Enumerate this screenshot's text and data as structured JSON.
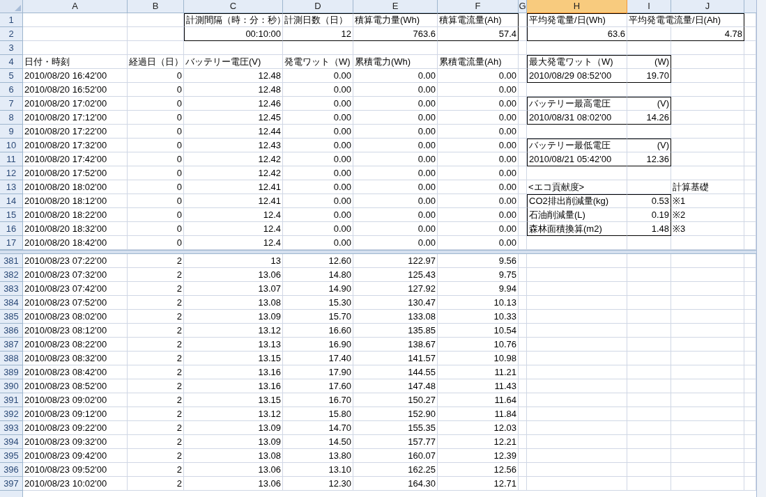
{
  "columns": [
    {
      "label": "A",
      "selected": false
    },
    {
      "label": "B",
      "selected": false
    },
    {
      "label": "C",
      "selected": false
    },
    {
      "label": "D",
      "selected": false
    },
    {
      "label": "E",
      "selected": false
    },
    {
      "label": "F",
      "selected": false
    },
    {
      "label": "G",
      "selected": false
    },
    {
      "label": "H",
      "selected": true
    },
    {
      "label": "I",
      "selected": false
    },
    {
      "label": "J",
      "selected": false
    }
  ],
  "panes": [
    {
      "rows": [
        {
          "n": "1",
          "cells": {
            "C": "計測間隔（時：分：秒）",
            "D": "計測日数（日）",
            "E": "積算電力量(Wh)",
            "F": "積算電流量(Ah)",
            "H": "平均発電量/日(Wh)",
            "I": "平均発電電流量/日(Ah)"
          }
        },
        {
          "n": "2",
          "cells": {
            "C": "00:10:00",
            "D": "12",
            "E": "763.6",
            "F": "57.4",
            "H": "63.6",
            "J": "4.78"
          }
        },
        {
          "n": "3",
          "cells": {}
        },
        {
          "n": "4",
          "cells": {
            "A": "日付・時刻",
            "B": "経過日（日）",
            "C": "バッテリー電圧(V)",
            "D": "発電ワット（W)",
            "E": "累積電力(Wh)",
            "F": "累積電流量(Ah)",
            "H": "最大発電ワット（W)",
            "I": "(W)"
          }
        },
        {
          "n": "5",
          "cells": {
            "A": "2010/08/20 16:42'00",
            "B": "0",
            "C": "12.48",
            "D": "0.00",
            "E": "0.00",
            "F": "0.00",
            "H": "2010/08/29 08:52'00",
            "I": "19.70"
          }
        },
        {
          "n": "6",
          "cells": {
            "A": "2010/08/20 16:52'00",
            "B": "0",
            "C": "12.48",
            "D": "0.00",
            "E": "0.00",
            "F": "0.00"
          }
        },
        {
          "n": "7",
          "cells": {
            "A": "2010/08/20 17:02'00",
            "B": "0",
            "C": "12.46",
            "D": "0.00",
            "E": "0.00",
            "F": "0.00",
            "H": "バッテリー最高電圧",
            "I": "(V)"
          }
        },
        {
          "n": "8",
          "cells": {
            "A": "2010/08/20 17:12'00",
            "B": "0",
            "C": "12.45",
            "D": "0.00",
            "E": "0.00",
            "F": "0.00",
            "H": "2010/08/31 08:02'00",
            "I": "14.26"
          }
        },
        {
          "n": "9",
          "cells": {
            "A": "2010/08/20 17:22'00",
            "B": "0",
            "C": "12.44",
            "D": "0.00",
            "E": "0.00",
            "F": "0.00"
          }
        },
        {
          "n": "10",
          "cells": {
            "A": "2010/08/20 17:32'00",
            "B": "0",
            "C": "12.43",
            "D": "0.00",
            "E": "0.00",
            "F": "0.00",
            "H": "バッテリー最低電圧",
            "I": "(V)"
          }
        },
        {
          "n": "11",
          "cells": {
            "A": "2010/08/20 17:42'00",
            "B": "0",
            "C": "12.42",
            "D": "0.00",
            "E": "0.00",
            "F": "0.00",
            "H": "2010/08/21 05:42'00",
            "I": "12.36"
          }
        },
        {
          "n": "12",
          "cells": {
            "A": "2010/08/20 17:52'00",
            "B": "0",
            "C": "12.42",
            "D": "0.00",
            "E": "0.00",
            "F": "0.00"
          }
        },
        {
          "n": "13",
          "cells": {
            "A": "2010/08/20 18:02'00",
            "B": "0",
            "C": "12.41",
            "D": "0.00",
            "E": "0.00",
            "F": "0.00",
            "H": "<エコ貢献度>",
            "J": "計算基礎"
          }
        },
        {
          "n": "14",
          "cells": {
            "A": "2010/08/20 18:12'00",
            "B": "0",
            "C": "12.41",
            "D": "0.00",
            "E": "0.00",
            "F": "0.00",
            "H": "CO2排出削減量(kg)",
            "I": "0.53",
            "J": "※1"
          }
        },
        {
          "n": "15",
          "cells": {
            "A": "2010/08/20 18:22'00",
            "B": "0",
            "C": "12.4",
            "D": "0.00",
            "E": "0.00",
            "F": "0.00",
            "H": "石油削減量(L)",
            "I": "0.19",
            "J": "※2"
          }
        },
        {
          "n": "16",
          "cells": {
            "A": "2010/08/20 18:32'00",
            "B": "0",
            "C": "12.4",
            "D": "0.00",
            "E": "0.00",
            "F": "0.00",
            "H": "森林面積換算(m2)",
            "I": "1.48",
            "J": "※3"
          }
        },
        {
          "n": "17",
          "cells": {
            "A": "2010/08/20 18:42'00",
            "B": "0",
            "C": "12.4",
            "D": "0.00",
            "E": "0.00",
            "F": "0.00"
          }
        }
      ]
    },
    {
      "rows": [
        {
          "n": "381",
          "cells": {
            "A": "2010/08/23 07:22'00",
            "B": "2",
            "C": "13",
            "D": "12.60",
            "E": "122.97",
            "F": "9.56"
          }
        },
        {
          "n": "382",
          "cells": {
            "A": "2010/08/23 07:32'00",
            "B": "2",
            "C": "13.06",
            "D": "14.80",
            "E": "125.43",
            "F": "9.75"
          }
        },
        {
          "n": "383",
          "cells": {
            "A": "2010/08/23 07:42'00",
            "B": "2",
            "C": "13.07",
            "D": "14.90",
            "E": "127.92",
            "F": "9.94"
          }
        },
        {
          "n": "384",
          "cells": {
            "A": "2010/08/23 07:52'00",
            "B": "2",
            "C": "13.08",
            "D": "15.30",
            "E": "130.47",
            "F": "10.13"
          }
        },
        {
          "n": "385",
          "cells": {
            "A": "2010/08/23 08:02'00",
            "B": "2",
            "C": "13.09",
            "D": "15.70",
            "E": "133.08",
            "F": "10.33"
          }
        },
        {
          "n": "386",
          "cells": {
            "A": "2010/08/23 08:12'00",
            "B": "2",
            "C": "13.12",
            "D": "16.60",
            "E": "135.85",
            "F": "10.54"
          }
        },
        {
          "n": "387",
          "cells": {
            "A": "2010/08/23 08:22'00",
            "B": "2",
            "C": "13.13",
            "D": "16.90",
            "E": "138.67",
            "F": "10.76"
          }
        },
        {
          "n": "388",
          "cells": {
            "A": "2010/08/23 08:32'00",
            "B": "2",
            "C": "13.15",
            "D": "17.40",
            "E": "141.57",
            "F": "10.98"
          }
        },
        {
          "n": "389",
          "cells": {
            "A": "2010/08/23 08:42'00",
            "B": "2",
            "C": "13.16",
            "D": "17.90",
            "E": "144.55",
            "F": "11.21"
          }
        },
        {
          "n": "390",
          "cells": {
            "A": "2010/08/23 08:52'00",
            "B": "2",
            "C": "13.16",
            "D": "17.60",
            "E": "147.48",
            "F": "11.43"
          }
        },
        {
          "n": "391",
          "cells": {
            "A": "2010/08/23 09:02'00",
            "B": "2",
            "C": "13.15",
            "D": "16.70",
            "E": "150.27",
            "F": "11.64"
          }
        },
        {
          "n": "392",
          "cells": {
            "A": "2010/08/23 09:12'00",
            "B": "2",
            "C": "13.12",
            "D": "15.80",
            "E": "152.90",
            "F": "11.84"
          }
        },
        {
          "n": "393",
          "cells": {
            "A": "2010/08/23 09:22'00",
            "B": "2",
            "C": "13.09",
            "D": "14.70",
            "E": "155.35",
            "F": "12.03"
          }
        },
        {
          "n": "394",
          "cells": {
            "A": "2010/08/23 09:32'00",
            "B": "2",
            "C": "13.09",
            "D": "14.50",
            "E": "157.77",
            "F": "12.21"
          }
        },
        {
          "n": "395",
          "cells": {
            "A": "2010/08/23 09:42'00",
            "B": "2",
            "C": "13.08",
            "D": "13.80",
            "E": "160.07",
            "F": "12.39"
          }
        },
        {
          "n": "396",
          "cells": {
            "A": "2010/08/23 09:52'00",
            "B": "2",
            "C": "13.06",
            "D": "13.10",
            "E": "162.25",
            "F": "12.56"
          }
        },
        {
          "n": "397",
          "cells": {
            "A": "2010/08/23 10:02'00",
            "B": "2",
            "C": "13.06",
            "D": "12.30",
            "E": "164.30",
            "F": "12.71"
          }
        }
      ]
    }
  ]
}
